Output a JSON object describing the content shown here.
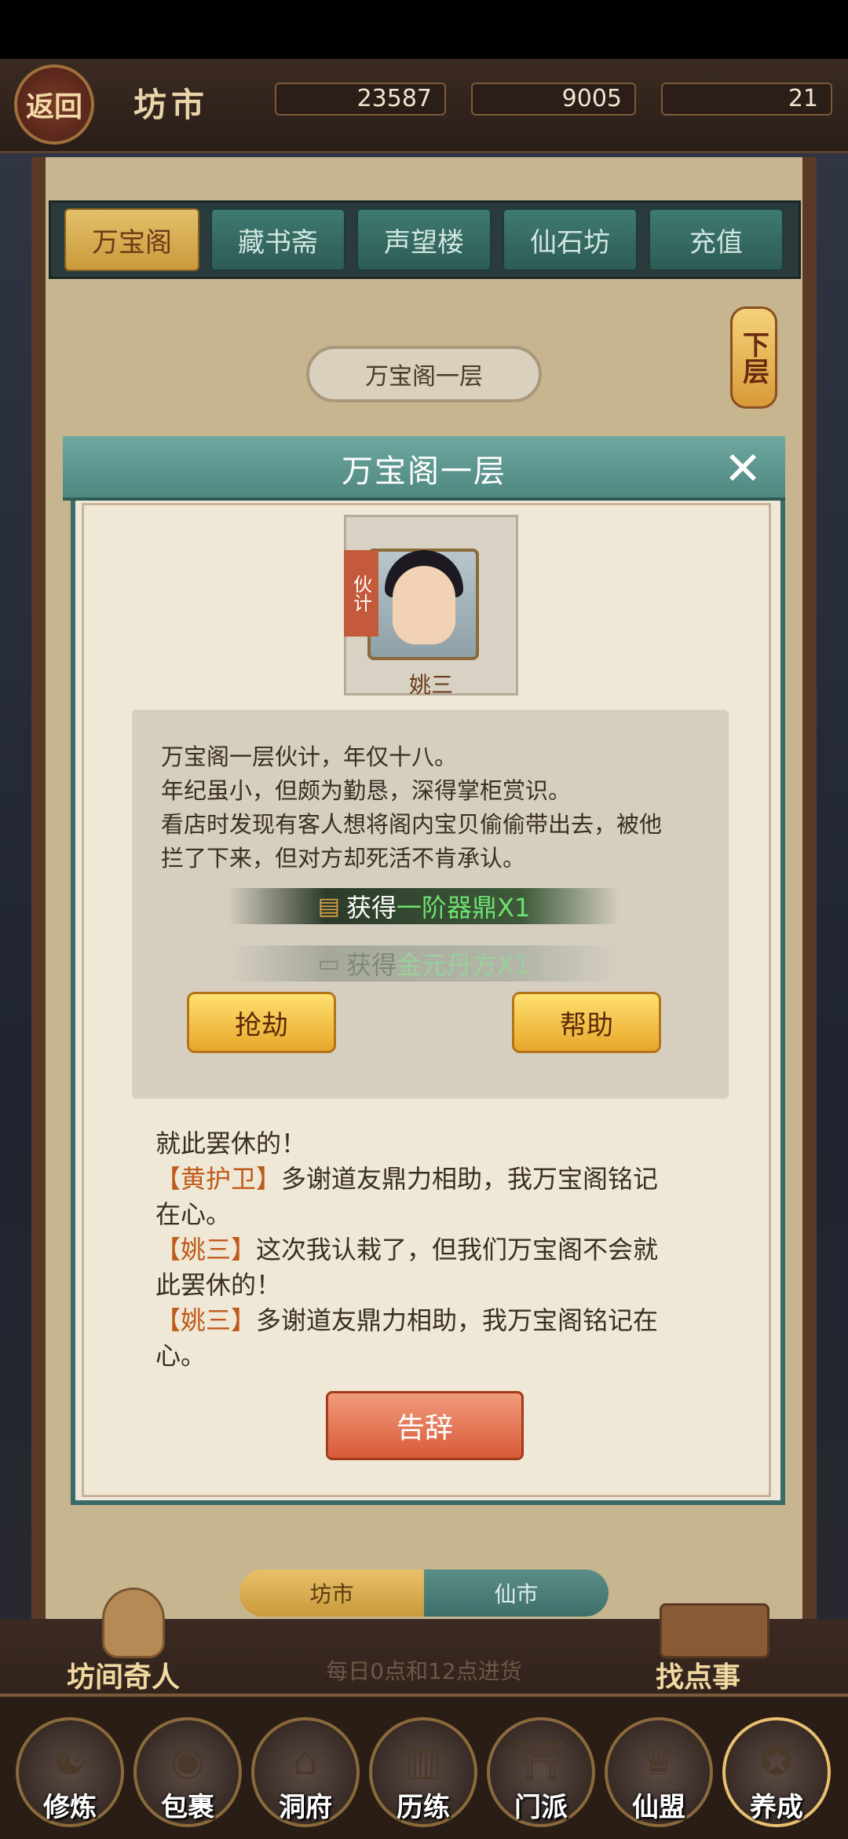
{
  "header": {
    "back_label": "返回",
    "title": "坊市"
  },
  "resources": [
    {
      "icon": "crystal-icon",
      "value": "23587",
      "color": "#3a6fe0"
    },
    {
      "icon": "gift-icon",
      "value": "9005",
      "color": "#d04030"
    },
    {
      "icon": "jade-icon",
      "value": "21",
      "color": "#3aa050"
    }
  ],
  "tabs": [
    {
      "label": "万宝阁"
    },
    {
      "label": "藏书斋"
    },
    {
      "label": "声望楼"
    },
    {
      "label": "仙石坊"
    },
    {
      "label": "充值"
    }
  ],
  "floor": {
    "current": "万宝阁一层",
    "next_label": "下层"
  },
  "dialog": {
    "title": "万宝阁一层",
    "npc": {
      "role": "伙计",
      "name": "姚三"
    },
    "story": [
      "万宝阁一层伙计，年仅十八。",
      "年纪虽小，但颇为勤恳，深得掌柜赏识。",
      "看店时发现有客人想将阁内宝贝偷偷带出去，被他",
      "拦了下来，但对方却死活不肯承认。"
    ],
    "rewards": [
      {
        "prefix": "获得",
        "item": "一阶器鼎X1"
      },
      {
        "prefix": "获得",
        "item": "金元丹方X1"
      }
    ],
    "buttons": {
      "rob": "抢劫",
      "help": "帮助",
      "leave": "告辞"
    },
    "log": [
      {
        "who": "",
        "text": "就此罢休的！"
      },
      {
        "who": "【黄护卫】",
        "text": "多谢道友鼎力相助，我万宝阁铭记"
      },
      {
        "who": "",
        "text": "在心。"
      },
      {
        "who": "【姚三】",
        "text": "这次我认栽了，但我们万宝阁不会就"
      },
      {
        "who": "",
        "text": "此罢休的！"
      },
      {
        "who": "【姚三】",
        "text": "多谢道友鼎力相助，我万宝阁铭记在"
      },
      {
        "who": "",
        "text": "心。"
      }
    ]
  },
  "market_switch": {
    "left": "坊市",
    "right": "仙市"
  },
  "restock_note": "每日0点和12点进货",
  "side_actions": {
    "left": "坊间奇人",
    "right": "找点事"
  },
  "nav": [
    {
      "label": "修炼",
      "icon": "cultivator-icon"
    },
    {
      "label": "包裹",
      "icon": "bag-icon"
    },
    {
      "label": "洞府",
      "icon": "residence-icon"
    },
    {
      "label": "历练",
      "icon": "scroll-icon"
    },
    {
      "label": "门派",
      "icon": "sect-gate-icon"
    },
    {
      "label": "仙盟",
      "icon": "alliance-banner-icon"
    },
    {
      "label": "养成",
      "icon": "pentagram-icon"
    }
  ]
}
